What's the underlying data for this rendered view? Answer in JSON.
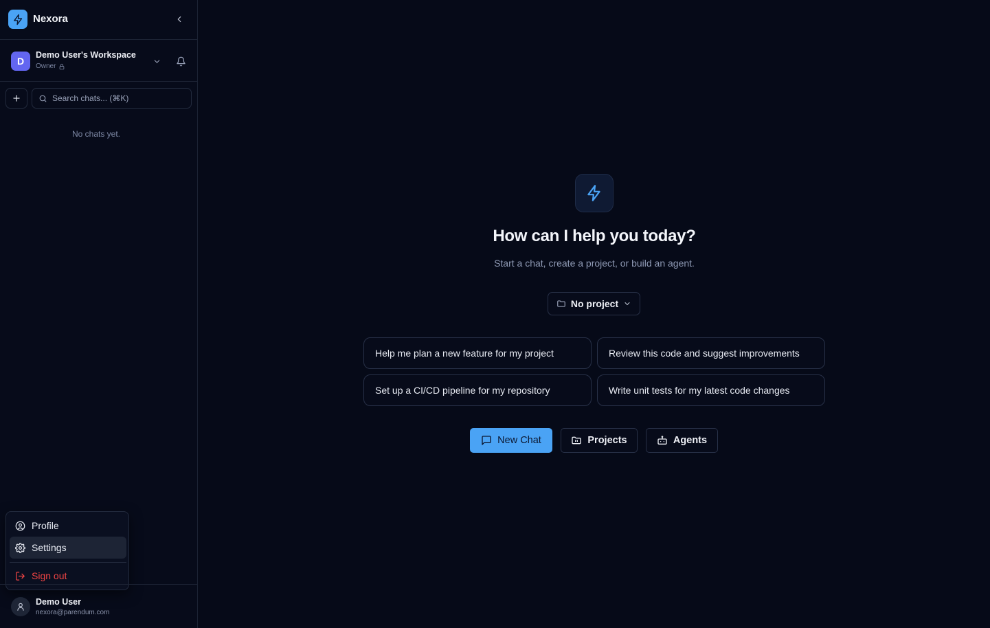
{
  "brand": {
    "name": "Nexora",
    "logo_icon": "bolt-icon"
  },
  "workspace": {
    "avatar_letter": "D",
    "name": "Demo User's Workspace",
    "role": "Owner"
  },
  "sidebar": {
    "search_placeholder": "Search chats... (⌘K)",
    "empty_text": "No chats yet."
  },
  "user_menu": {
    "items": [
      {
        "label": "Profile",
        "icon": "user-circle-icon"
      },
      {
        "label": "Settings",
        "icon": "gear-icon"
      },
      {
        "label": "Sign out",
        "icon": "logout-icon"
      }
    ]
  },
  "user": {
    "name": "Demo User",
    "email": "nexora@parendum.com"
  },
  "hero": {
    "title": "How can I help you today?",
    "subtitle": "Start a chat, create a project, or build an agent."
  },
  "project_selector": {
    "label": "No project"
  },
  "suggestions": [
    "Help me plan a new feature for my project",
    "Review this code and suggest improvements",
    "Set up a CI/CD pipeline for my repository",
    "Write unit tests for my latest code changes"
  ],
  "actions": {
    "new_chat": "New Chat",
    "projects": "Projects",
    "agents": "Agents"
  },
  "colors": {
    "accent": "#4aa3f5",
    "background": "#060a18",
    "danger": "#ef4444",
    "workspace_avatar": "#6366f1"
  }
}
